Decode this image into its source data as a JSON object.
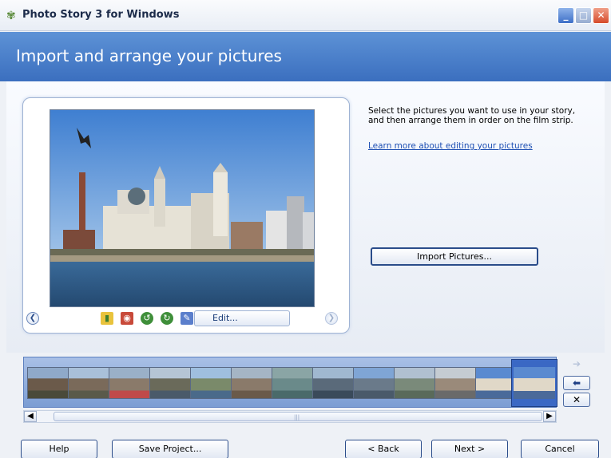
{
  "window": {
    "title": "Photo Story 3 for Windows",
    "app_icon": "photo-story-icon",
    "controls": [
      "minimize",
      "maximize",
      "close"
    ]
  },
  "header": {
    "title": "Import and arrange your pictures"
  },
  "preview": {
    "prev_icon": "arrow-left-circle-icon",
    "next_icon": "arrow-right-circle-icon",
    "tools": [
      {
        "icon": "auto-color-correct-icon"
      },
      {
        "icon": "remove-red-eye-icon"
      },
      {
        "icon": "rotate-left-icon"
      },
      {
        "icon": "rotate-right-icon"
      }
    ],
    "edit_label": "Edit..."
  },
  "instructions": {
    "line1": "Select the pictures you want to use in your story,",
    "line2": "and then arrange them in order on the film strip.",
    "link": "Learn more about editing your pictures"
  },
  "import_button": "Import Pictures...",
  "filmstrip": {
    "thumbnail_count": 13,
    "selected_index": 12
  },
  "bottom": {
    "help": "Help",
    "save": "Save Project...",
    "back": "< Back",
    "next": "Next >",
    "cancel": "Cancel"
  },
  "colors": {
    "header_blue": "#3b6fbf",
    "selected_thumb": "#3a68c4"
  }
}
